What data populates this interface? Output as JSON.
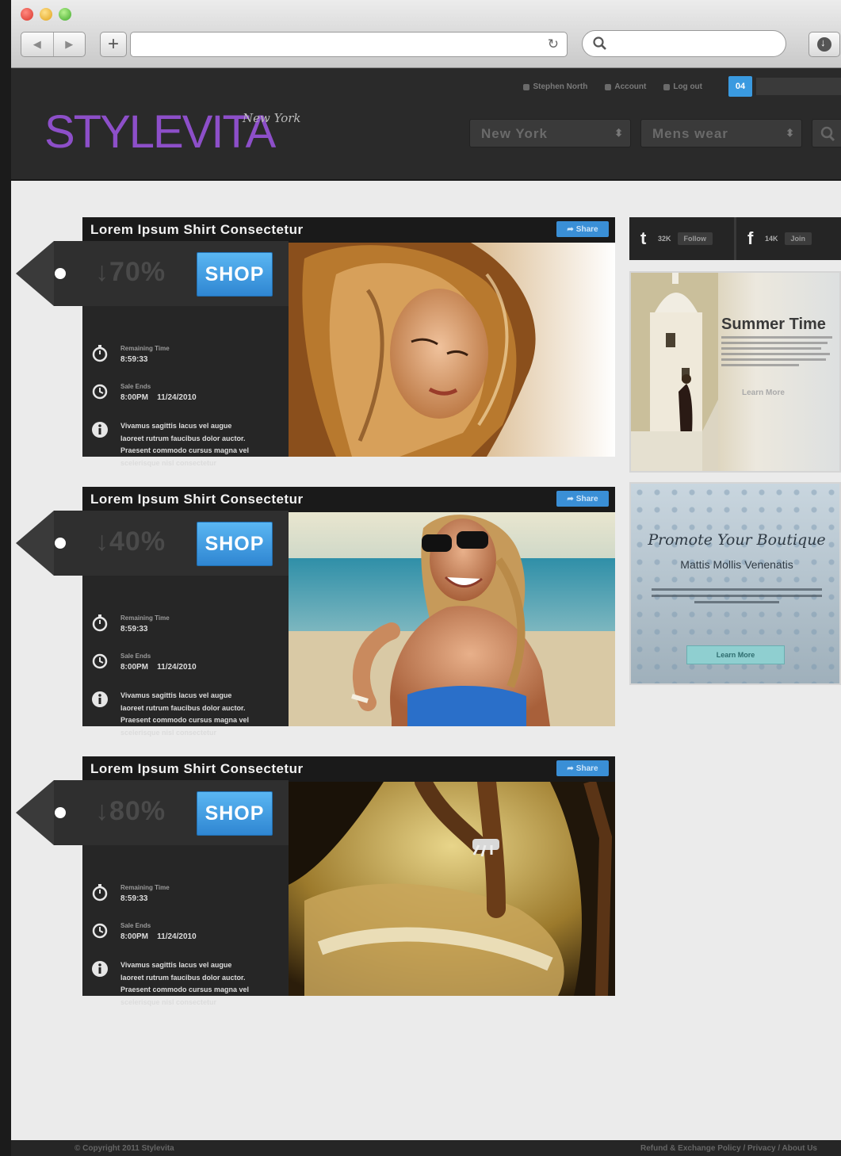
{
  "header": {
    "logo": "STYLEVITA",
    "logo_sub": "New York",
    "nav": [
      "Stephen North",
      "Account",
      "Log out"
    ],
    "cart_count": "04",
    "select_city": "New York",
    "select_category": "Mens wear"
  },
  "deals": [
    {
      "title": "Lorem Ipsum Shirt Consectetur",
      "share": "Share",
      "discount": "70%",
      "shop": "SHOP",
      "remaining_label": "Remaining Time",
      "remaining_value": "8:59:33",
      "ends_label": "Sale Ends",
      "ends_time": "8:00PM",
      "ends_date": "11/24/2010",
      "description": "Vivamus sagittis lacus vel augue laoreet rutrum faucibus dolor auctor. Praesent commodo cursus magna vel scelerisque nisl consectetur",
      "image": "woman-windblown-hair"
    },
    {
      "title": "Lorem Ipsum Shirt Consectetur",
      "share": "Share",
      "discount": "40%",
      "shop": "SHOP",
      "remaining_label": "Remaining Time",
      "remaining_value": "8:59:33",
      "ends_label": "Sale Ends",
      "ends_time": "8:00PM",
      "ends_date": "11/24/2010",
      "description": "Vivamus sagittis lacus vel augue laoreet rutrum faucibus dolor auctor. Praesent commodo cursus magna vel scelerisque nisl consectetur",
      "image": "woman-beach-sunglasses"
    },
    {
      "title": "Lorem Ipsum Shirt Consectetur",
      "share": "Share",
      "discount": "80%",
      "shop": "SHOP",
      "remaining_label": "Remaining Time",
      "remaining_value": "8:59:33",
      "ends_label": "Sale Ends",
      "ends_time": "8:00PM",
      "ends_date": "11/24/2010",
      "description": "Vivamus sagittis lacus vel augue laoreet rutrum faucibus dolor auctor. Praesent commodo cursus magna vel scelerisque nisl consectetur",
      "image": "hands-sand-beach"
    }
  ],
  "social": {
    "twitter_count": "32K",
    "twitter_button": "Follow",
    "facebook_count": "14K",
    "facebook_button": "Join"
  },
  "promo_summer": {
    "title": "Summer Time",
    "learn_more": "Learn More"
  },
  "promo_boutique": {
    "title": "Promote Your Boutique",
    "subtitle": "Mattis Mollis Venenatis",
    "button": "Learn More"
  },
  "footer": {
    "copyright": "© Copyright 2011 Stylevita",
    "links": "Refund & Exchange Policy / Privacy / About Us"
  },
  "colors": {
    "accent_blue": "#3a9ae0",
    "logo_purple": "#8d4fc9",
    "dark_panel": "#262626"
  }
}
